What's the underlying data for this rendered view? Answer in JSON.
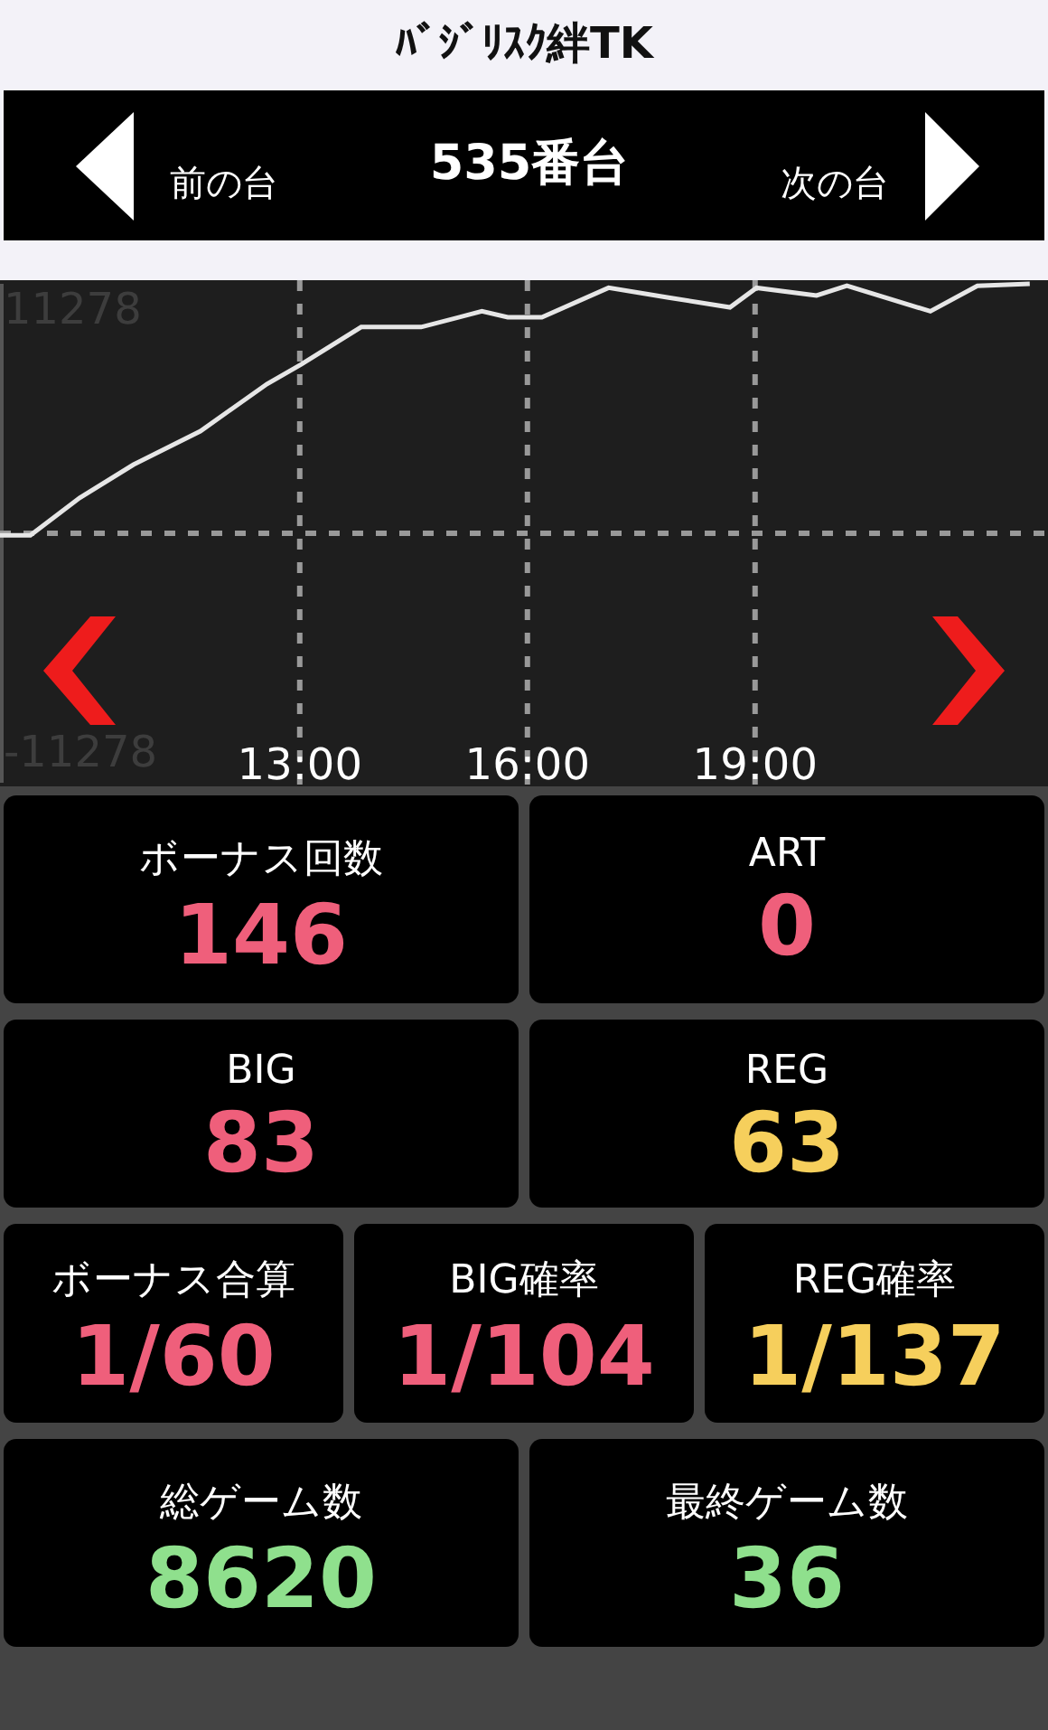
{
  "title": "ﾊﾞｼﾞﾘｽｸ絆TK",
  "nav": {
    "prev": "前の台",
    "machine": "535番台",
    "next": "次の台"
  },
  "chart": {
    "chart_data": {
      "type": "line",
      "x": [
        9.05,
        9.45,
        10.1,
        10.81,
        11.69,
        12.57,
        13.02,
        13.81,
        14.6,
        15.4,
        15.74,
        16.19,
        17.07,
        17.86,
        18.67,
        19.02,
        19.81,
        20.21,
        21.31,
        21.93,
        22.62
      ],
      "series": [
        {
          "color": "#e6e6e6",
          "values": [
            -100,
            -100,
            1800,
            3500,
            5200,
            7600,
            8600,
            10500,
            10500,
            11300,
            11000,
            11000,
            12500,
            12000,
            11500,
            12500,
            12100,
            12600,
            11300,
            12600,
            12700
          ]
        }
      ],
      "xlim": [
        9.05,
        22.86
      ],
      "ylim": [
        -12700,
        12700
      ],
      "grid": true,
      "xticks": [
        {
          "value": 13,
          "label": "13:00"
        },
        {
          "value": 16,
          "label": "16:00"
        },
        {
          "value": 19,
          "label": "19:00"
        }
      ],
      "yticks": [
        {
          "value": 11278,
          "label": "11278"
        },
        {
          "value": -11278,
          "label": "-11278"
        }
      ]
    }
  },
  "rows": [
    {
      "cells": [
        {
          "label": "ボーナス回数",
          "value": "146",
          "color": "#ef5f7b"
        },
        {
          "label": "ART",
          "value": "0",
          "color": "#ef5f7b"
        }
      ]
    },
    {
      "cells": [
        {
          "label": "BIG",
          "value": "83",
          "color": "#ef5f7b"
        },
        {
          "label": "REG",
          "value": "63",
          "color": "#f6cf5c"
        }
      ]
    },
    {
      "cells": [
        {
          "label": "ボーナス合算",
          "value": "1/60",
          "color": "#ef5f7b"
        },
        {
          "label": "BIG確率",
          "value": "1/104",
          "color": "#ef5f7b"
        },
        {
          "label": "REG確率",
          "value": "1/137",
          "color": "#f6cf5c"
        }
      ]
    },
    {
      "cells": [
        {
          "label": "総ゲーム数",
          "value": "8620",
          "color": "#8fe08d"
        },
        {
          "label": "最終ゲーム数",
          "value": "36",
          "color": "#8fe08d"
        }
      ]
    }
  ]
}
